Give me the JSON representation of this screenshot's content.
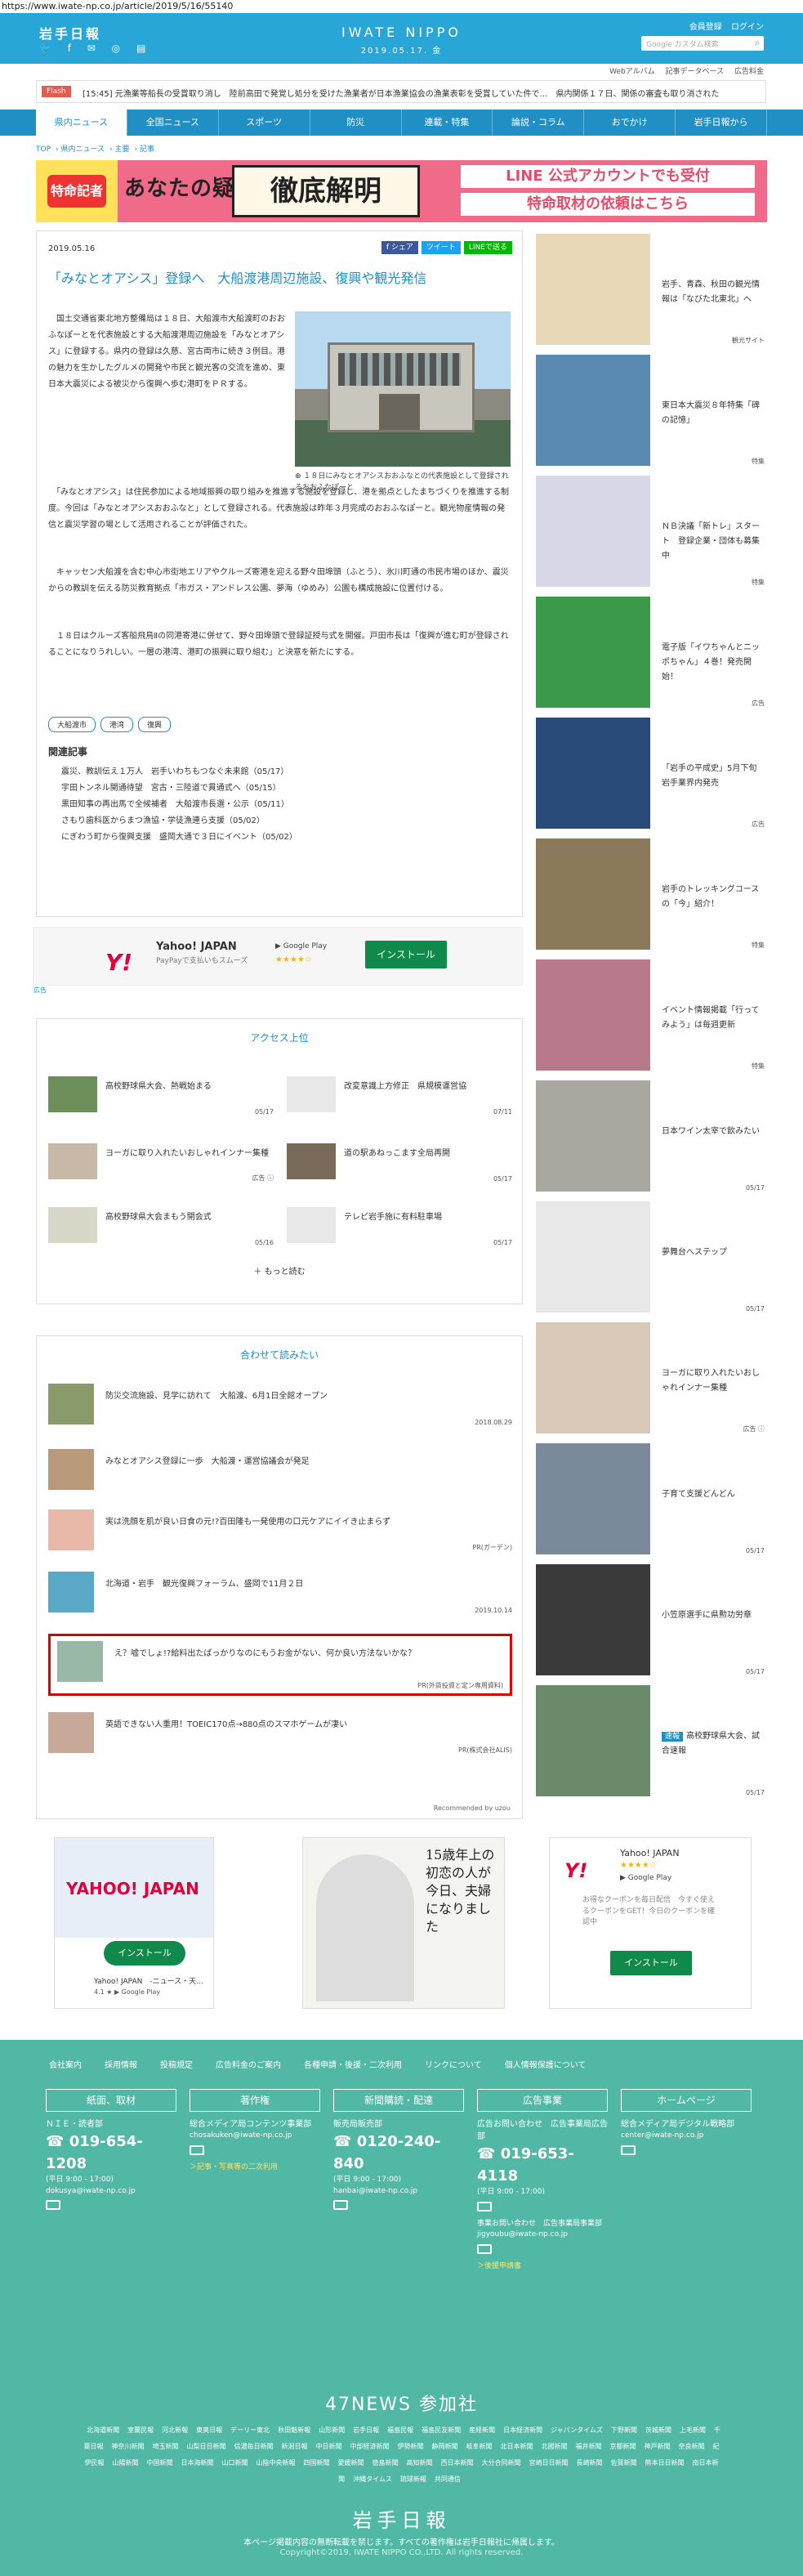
{
  "url": "https://www.iwate-np.co.jp/article/2019/5/16/55140",
  "header": {
    "logo": "岩手日報",
    "sns": "🐦 f ✉ ◎ ▤",
    "brand": "IWATE NIPPO",
    "date": "2019.05.17. 金",
    "member": "会員登録",
    "login": "ログイン",
    "search_placeholder": "Google カスタム検索",
    "search_icon": "search-icon"
  },
  "subnav": [
    "Webアルバム",
    "記事データベース",
    "広告料金"
  ],
  "flash": {
    "label": "Flash",
    "text": "[15:45] 元漁業等船長の受賞取り消し　陸前高田で発覚し処分を受けた漁業者が日本漁業協会の漁業表彰を受賞していた件で…　県内関係１７日、関係の審査も取り消された"
  },
  "nav": [
    "県内ニュース",
    "全国ニュース",
    "スポーツ",
    "防災",
    "連載・特集",
    "論説・コラム",
    "おでかけ",
    "岩手日報から"
  ],
  "breadcrumb": [
    "TOP",
    "県内ニュース",
    "主要",
    "記事"
  ],
  "banner": {
    "tag": "特命記者",
    "q": "あなたの疑問",
    "big": "徹底解明",
    "line1": "LINE 公式アカウントでも受付",
    "line2": "特命取材の依頼はこちら"
  },
  "article": {
    "date": "2019.05.16",
    "share": [
      "f シェア",
      "ツイート",
      "LINEで送る"
    ],
    "title": "「みなとオアシス」登録へ　大船渡港周辺施設、復興や観光発信",
    "caption": "１８日にみなとオアシスおおふなとの代表施設として登録されるおおふなぽーと",
    "p1": "　国土交通省東北地方整備局は１８日、大船渡市大船渡町のおおふなぽーとを代表施設とする大船渡港周辺施設を「みなとオアシス」に登録する。県内の登録は久慈、宮古両市に続き３例目。港の魅力を生かしたグルメの開発や市民と観光客の交流を進め、東日本大震災による被災から復興へ歩む港町をＰＲする。",
    "p2": "　「みなとオアシス」は住民参加による地域振興の取り組みを推進する施設を登録し、港を拠点としたまちづくりを推進する制度。今回は「みなとオアシスおおふなと」として登録される。代表施設は昨年３月完成のおおふなぽーと。観光物産情報の発信と震災学習の場として活用されることが評価された。",
    "p3": "　キャッセン大船渡を含む中心市街地エリアやクルーズ寄港を迎える野々田埠頭（ふとう）、氷川町通の市民市場のほか、震災からの教訓を伝える防災教育拠点「市ガス・アンドレス公園、夢海（ゆめみ）公園も構成施設に位置付ける。",
    "p4": "　１８日はクルーズ客船飛鳥Ⅱの同港寄港に併せて、野々田埠頭で登録証授与式を開催。戸田市長は「復興が進む町が登録されることになりうれしい。一層の港湾、港町の振興に取り組む」と決意を新たにする。",
    "tags": [
      "大船渡市",
      "港湾",
      "復興"
    ],
    "related_title": "関連記事",
    "related": [
      "震災、教訓伝え１万人　岩手いわちもつなぐ未来館（05/17）",
      "宇田トンネル開通待望　宮古・三陸道で貫通式へ（05/15）",
      "黒田知事の再出馬で全候補者　大船渡市長選・公示（05/11）",
      "さもり歯科医からまつ漁協・学徒漁連ら支援（05/02）",
      "にぎわう町から復興支援　盛岡大通で３日にイベント（05/02）"
    ]
  },
  "ad1": {
    "logo": "Y!",
    "name": "Yahoo! JAPAN",
    "sub": "PayPayで支払いもスムーズ",
    "store": "▶ Google Play",
    "stars": "★★★★☆",
    "btn": "インストール",
    "tag": "広告"
  },
  "ranking": {
    "title": "アクセス上位",
    "items": [
      {
        "t": "高校野球県大会、熱戦始まる",
        "d": "05/17"
      },
      {
        "t": "改変意識上方修正　県規模運営協",
        "d": "07/11"
      },
      {
        "t": "ヨーガに取り入れたいおしゃれインナー集種",
        "d": "広告 ⓘ"
      },
      {
        "t": "道の駅あねっこます全局再開",
        "d": "05/17"
      },
      {
        "t": "高校野球県大会まもう開会式",
        "d": "05/16"
      },
      {
        "t": "テレビ岩手施に有料駐車場",
        "d": "05/17"
      }
    ],
    "more": "＋ もっと読む"
  },
  "recommend": {
    "title": "合わせて読みたい",
    "items": [
      {
        "t": "防災交流施設、見学に訪れて　大船渡、6月1日全館オープン",
        "d": "2018.08.29"
      },
      {
        "t": "みなとオアシス登録に一歩　大船渡・運営協議会が発足",
        "d": ""
      },
      {
        "t": "実は洗顔を肌が良い日食の元!?百田隆も一発使用の口元ケアにイイき止まらず",
        "d": "PR(ガーデン)"
      },
      {
        "t": "北海道・岩手　観光復興フォーラム、盛岡で11月２日",
        "d": "2019.10.14"
      },
      {
        "t": "え？嘘でしょ!?給料出たばっかりなのにもうお金がない、何か良い方法ないかな？",
        "d": "PR(外貨投資と定ン専用資料)"
      },
      {
        "t": "英語できない人重用！TOEIC170点→880点のスマホゲームが凄い",
        "d": "PR(株式会社ALIS)"
      }
    ],
    "credit": "Recommended by uzou"
  },
  "ad2": {
    "logo": "YAHOO! JAPAN",
    "btn": "インストール",
    "name": "Yahoo! JAPAN　-ニュース・天...",
    "rate": "4.1 ★ ▶ Google Play"
  },
  "ad3": {
    "text": "15歳年上の初恋の人が今日、夫婦になりました"
  },
  "ad4": {
    "logo": "Y!",
    "name": "Yahoo! JAPAN",
    "stars": "★★★★☆",
    "store": "▶ Google Play",
    "desc": "お得なクーポンを毎日配信　今すぐ使えるクーポンをGET！今日のクーポンを確認中",
    "btn": "インストール"
  },
  "sidebar": [
    {
      "t": "岩手、青森、秋田の観光情報は「なびた北東北」へ",
      "s": "観光サイト"
    },
    {
      "t": "東日本大震災８年特集「碑の記憶」",
      "s": "特集"
    },
    {
      "t": "ＮＢ決議「新トレ」スタート　登録企業・団体も募集中",
      "s": "特集"
    },
    {
      "t": "電子版「イワちゃんとニッポちゃん」４巻！発売開始！",
      "s": "広告"
    },
    {
      "t": "「岩手の平成史」5月下旬岩手業界内発売",
      "s": "広告"
    },
    {
      "t": "岩手のトレッキングコースの「今」紹介！",
      "s": "特集"
    },
    {
      "t": "イベント情報掲載「行ってみよう」は毎週更新",
      "s": "特集"
    },
    {
      "t": "日本ワイン太宰で飲みたい",
      "s": "05/17"
    },
    {
      "t": "夢舞台へステップ",
      "s": "05/17"
    },
    {
      "t": "ヨーガに取り入れたいおしゃれインナー集種",
      "s": "広告 ⓘ"
    },
    {
      "t": "子育て支援どんどん",
      "s": "05/17"
    },
    {
      "t": "小笠原選手に県勲功労章",
      "s": "05/17"
    },
    {
      "t": "高校野球県大会、試合速報",
      "s": "05/17",
      "badge": "速報"
    }
  ],
  "footer": {
    "links": [
      "会社案内",
      "採用情報",
      "投稿規定",
      "広告料金のご案内",
      "各種申請・後援・二次利用",
      "リンクについて",
      "個人情報保護について"
    ],
    "cols": [
      {
        "h": "紙面、取材",
        "l1": "ＮＩＥ・読者部",
        "tel": "☎ 019-654-1208",
        "hrs": "(平日 9:00 - 17:00)",
        "mail": "dokusya@iwate-np.co.jp",
        "extra": ""
      },
      {
        "h": "著作権",
        "l1": "総合メディア局コンテンツ事業部",
        "tel": "",
        "hrs": "",
        "mail": "chosakuken@iwate-np.co.jp",
        "extra": "＞記事・写真等の二次利用"
      },
      {
        "h": "新聞購読・配達",
        "l1": "販売局販売部",
        "tel": "☎ 0120-240-840",
        "hrs": "(平日 9:00 - 17:00)",
        "mail": "hanbai@iwate-np.co.jp",
        "extra": ""
      },
      {
        "h": "広告事業",
        "l1": "広告お問い合わせ　広告事業局広告部",
        "tel": "☎ 019-653-4118",
        "hrs": "(平日 9:00 - 17:00)",
        "mail": "事業お問い合わせ　広告事業局事業部　jigyoubu@iwate-np.co.jp",
        "extra": "＞後援申請書"
      },
      {
        "h": "ホームページ",
        "l1": "総合メディア局デジタル戦略部",
        "tel": "",
        "hrs": "",
        "mail": "center@iwate-np.co.jp",
        "extra": ""
      }
    ],
    "n47": "47NEWS 参加社",
    "papers": [
      "北海道新聞",
      "室蘭民報",
      "河北新報",
      "東奥日報",
      "デーリー東北",
      "秋田魁新報",
      "山形新聞",
      "岩手日報",
      "福島民報",
      "福島民友新聞",
      "産経新聞",
      "日本経済新聞",
      "ジャパンタイムズ",
      "下野新聞",
      "茨城新聞",
      "上毛新聞",
      "千葉日報",
      "神奈川新聞",
      "埼玉新聞",
      "山梨日日新聞",
      "信濃毎日新聞",
      "新潟日報",
      "中日新聞",
      "中部経済新聞",
      "伊勢新聞",
      "静岡新聞",
      "岐阜新聞",
      "北日本新聞",
      "北國新聞",
      "福井新聞",
      "京都新聞",
      "神戸新聞",
      "奈良新聞",
      "紀伊民報",
      "山陽新聞",
      "中国新聞",
      "日本海新聞",
      "山口新聞",
      "山陰中央新報",
      "四国新聞",
      "愛媛新聞",
      "徳島新聞",
      "高知新聞",
      "西日本新聞",
      "大分合同新聞",
      "宮崎日日新聞",
      "長崎新聞",
      "佐賀新聞",
      "熊本日日新聞",
      "南日本新聞",
      "沖縄タイムス",
      "琉球新報",
      "共同通信"
    ],
    "logo": "岩手日報",
    "note": "本ページ掲載内容の無断転載を禁じます。すべての著作権は岩手日報社に帰属します。",
    "copy": "Copyright©2019, IWATE NIPPO CO.,LTD. All rights reserved."
  }
}
